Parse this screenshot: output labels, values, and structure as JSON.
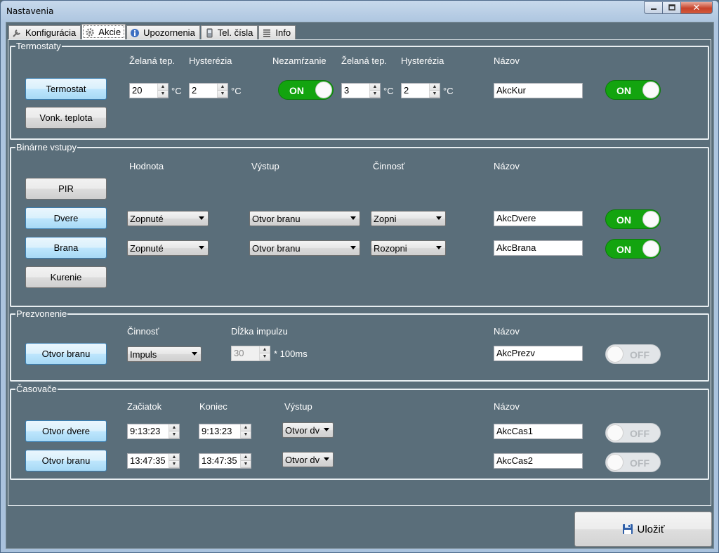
{
  "window": {
    "title": "Nastavenia",
    "close_glyph": "✕"
  },
  "tabs": [
    {
      "label": "Konfigurácia",
      "icon": "wrench-icon"
    },
    {
      "label": "Akcie",
      "icon": "gear-icon"
    },
    {
      "label": "Upozornenia",
      "icon": "info-icon"
    },
    {
      "label": "Tel. čísla",
      "icon": "phone-icon"
    },
    {
      "label": "Info",
      "icon": "list-icon"
    }
  ],
  "termostaty": {
    "legend": "Termostaty",
    "headers": {
      "target1": "Želaná tep.",
      "hyst1": "Hysterézia",
      "freeze": "Nezamŕzanie",
      "target2": "Želaná tep.",
      "hyst2": "Hysterézia",
      "name": "Názov"
    },
    "buttons": {
      "termostat": "Termostat",
      "vonk": "Vonk. teplota"
    },
    "unit": "°C",
    "target1": "20",
    "hyst1": "2",
    "freeze_toggle": "ON",
    "target2": "3",
    "hyst2": "2",
    "name": "AkcKur",
    "enabled_toggle": "ON"
  },
  "binarne": {
    "legend": "Binárne vstupy",
    "headers": {
      "value": "Hodnota",
      "output": "Výstup",
      "action": "Činnosť",
      "name": "Názov"
    },
    "buttons": {
      "pir": "PIR",
      "dvere": "Dvere",
      "brana": "Brana",
      "kurenie": "Kurenie"
    },
    "rows": [
      {
        "value": "Zopnuté",
        "output": "Otvor branu",
        "action": "Zopni",
        "name": "AkcDvere",
        "toggle": "ON"
      },
      {
        "value": "Zopnuté",
        "output": "Otvor branu",
        "action": "Rozopni",
        "name": "AkcBrana",
        "toggle": "ON"
      }
    ]
  },
  "prezvonenie": {
    "legend": "Prezvonenie",
    "headers": {
      "action": "Činnosť",
      "pulse": "Dĺžka impulzu",
      "name": "Názov"
    },
    "button": "Otvor branu",
    "action": "Impuls",
    "pulse": "30",
    "pulse_unit": "* 100ms",
    "name": "AkcPrezv",
    "toggle": "OFF"
  },
  "casovace": {
    "legend": "Časovače",
    "headers": {
      "start": "Začiatok",
      "end": "Koniec",
      "output": "Výstup",
      "name": "Názov"
    },
    "rows": [
      {
        "button": "Otvor dvere",
        "start": "9:13:23",
        "end": "9:13:23",
        "output": "Otvor dv",
        "name": "AkcCas1",
        "toggle": "OFF"
      },
      {
        "button": "Otvor branu",
        "start": "13:47:35",
        "end": "13:47:35",
        "output": "Otvor dv",
        "name": "AkcCas2",
        "toggle": "OFF"
      }
    ]
  },
  "save_button": {
    "label": "Uložiť",
    "icon": "floppy-disk-icon"
  },
  "spinner_arrows": {
    "up": "▲",
    "down": "▼"
  }
}
